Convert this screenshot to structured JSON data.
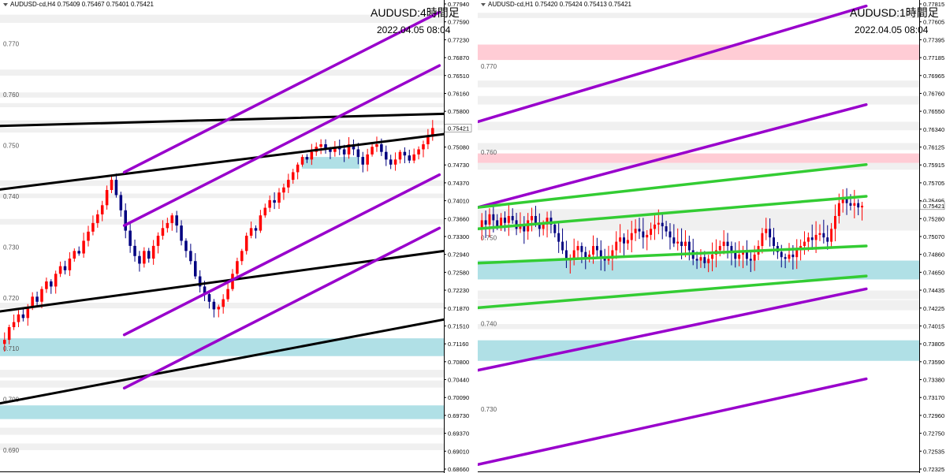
{
  "colors": {
    "purple": "#9900cc",
    "black": "#000000",
    "green": "#33cc33",
    "pink": "#ffccd5",
    "cyan": "#b0e0e6",
    "band": "#f0f0f0",
    "bull": "#ff0000",
    "bear": "#000080",
    "axis": "#000000",
    "price_label_bg": "#f0f0f0"
  },
  "chart_data": [
    {
      "type": "candlestick",
      "header": "AUDUSD-cd,H4  0.75409 0.75467 0.75401 0.75421",
      "title": "AUDUSD:4時間足",
      "timestamp": "2022.04.05 08:04",
      "ylim": [
        0.6866,
        0.7794
      ],
      "grid_labels": [
        "0.770",
        "0.760",
        "0.750",
        "0.740",
        "0.730",
        "0.720",
        "0.710",
        "0.700",
        "0.690"
      ],
      "grid_values": [
        0.77,
        0.76,
        0.75,
        0.74,
        0.73,
        0.72,
        0.71,
        0.7,
        0.69
      ],
      "axis_ticks": [
        "0.77940",
        "0.77590",
        "0.77230",
        "0.76870",
        "0.76510",
        "0.76160",
        "0.75800",
        "0.75421",
        "0.75080",
        "0.74730",
        "0.74370",
        "0.74010",
        "0.73660",
        "0.73300",
        "0.72940",
        "0.72580",
        "0.72230",
        "0.71870",
        "0.71510",
        "0.71160",
        "0.70800",
        "0.70440",
        "0.70090",
        "0.69730",
        "0.69370",
        "0.69010",
        "0.68660"
      ],
      "current_price": "0.75421",
      "zones": [
        {
          "kind": "band",
          "y1": 0.7765,
          "y2": 0.7749
        },
        {
          "kind": "band",
          "y1": 0.7657,
          "y2": 0.7645
        },
        {
          "kind": "band",
          "y1": 0.7612,
          "y2": 0.7602
        },
        {
          "kind": "band",
          "y1": 0.7591,
          "y2": 0.7583
        },
        {
          "kind": "band",
          "y1": 0.7557,
          "y2": 0.7548
        },
        {
          "kind": "band",
          "y1": 0.7542,
          "y2": 0.7533
        },
        {
          "kind": "cyan",
          "y1": 0.7485,
          "y2": 0.7462
        },
        {
          "kind": "band",
          "y1": 0.7439,
          "y2": 0.7428
        },
        {
          "kind": "band",
          "y1": 0.7413,
          "y2": 0.7404
        },
        {
          "kind": "band",
          "y1": 0.7363,
          "y2": 0.7352
        },
        {
          "kind": "band",
          "y1": 0.7198,
          "y2": 0.7187
        },
        {
          "kind": "cyan",
          "y1": 0.7128,
          "y2": 0.7093
        },
        {
          "kind": "band",
          "y1": 0.7066,
          "y2": 0.7051
        },
        {
          "kind": "band",
          "y1": 0.7045,
          "y2": 0.7031
        },
        {
          "kind": "cyan",
          "y1": 0.6996,
          "y2": 0.6969
        },
        {
          "kind": "band",
          "y1": 0.6952,
          "y2": 0.6938
        },
        {
          "kind": "band",
          "y1": 0.6921,
          "y2": 0.6908
        }
      ],
      "lines": [
        {
          "color": "black",
          "t1": 0,
          "p1": 0.7546,
          "t2": 1,
          "p2": 0.757
        },
        {
          "color": "black",
          "t1": 0,
          "p1": 0.7421,
          "t2": 1,
          "p2": 0.753
        },
        {
          "color": "black",
          "t1": 0,
          "p1": 0.7,
          "t2": 1,
          "p2": 0.7165
        },
        {
          "color": "black",
          "t1": 0,
          "p1": 0.7181,
          "t2": 1,
          "p2": 0.73
        },
        {
          "color": "purple",
          "t1": 0.28,
          "p1": 0.7455,
          "t2": 0.99,
          "p2": 0.777
        },
        {
          "color": "purple",
          "t1": 0.28,
          "p1": 0.735,
          "t2": 0.99,
          "p2": 0.7665
        },
        {
          "color": "purple",
          "t1": 0.28,
          "p1": 0.7135,
          "t2": 0.99,
          "p2": 0.745
        },
        {
          "color": "purple",
          "t1": 0.28,
          "p1": 0.703,
          "t2": 0.99,
          "p2": 0.7345
        }
      ],
      "candles": {
        "t_start": 0.005,
        "t_end": 0.98,
        "close": [
          0.7125,
          0.715,
          0.716,
          0.7175,
          0.7168,
          0.719,
          0.721,
          0.72,
          0.7225,
          0.724,
          0.723,
          0.7255,
          0.727,
          0.7262,
          0.7285,
          0.73,
          0.7295,
          0.732,
          0.7338,
          0.7355,
          0.7372,
          0.739,
          0.742,
          0.744,
          0.741,
          0.738,
          0.734,
          0.731,
          0.729,
          0.7275,
          0.73,
          0.7285,
          0.731,
          0.733,
          0.7345,
          0.7355,
          0.737,
          0.735,
          0.732,
          0.73,
          0.728,
          0.725,
          0.723,
          0.7215,
          0.72,
          0.7185,
          0.719,
          0.7205,
          0.7225,
          0.7255,
          0.728,
          0.73,
          0.733,
          0.7345,
          0.734,
          0.737,
          0.7385,
          0.74,
          0.7395,
          0.7415,
          0.7425,
          0.744,
          0.7455,
          0.747,
          0.7485,
          0.748,
          0.7495,
          0.7505,
          0.751,
          0.75,
          0.7495,
          0.7505,
          0.75,
          0.749,
          0.751,
          0.75,
          0.7485,
          0.747,
          0.749,
          0.7505,
          0.751,
          0.7495,
          0.748,
          0.747,
          0.748,
          0.7495,
          0.7488,
          0.7478,
          0.749,
          0.75,
          0.751,
          0.7525,
          0.7542
        ]
      }
    },
    {
      "type": "candlestick",
      "header": "AUDUSD-cd,H1  0.75420 0.75424 0.75413 0.75421",
      "title": "AUDUSD:1時間足",
      "timestamp": "2022.04.05 08:04",
      "ylim": [
        0.7232,
        0.7782
      ],
      "grid_labels": [
        "0.770",
        "0.760",
        "0.750",
        "0.740",
        "0.730"
      ],
      "grid_values": [
        0.77,
        0.76,
        0.75,
        0.74,
        0.73
      ],
      "axis_ticks": [
        "0.77815",
        "0.77605",
        "0.77395",
        "0.77185",
        "0.76965",
        "0.76760",
        "0.76550",
        "0.76340",
        "0.76125",
        "0.75915",
        "0.75705",
        "0.75495",
        "0.75280",
        "0.75070",
        "0.74860",
        "0.74650",
        "0.74435",
        "0.74225",
        "0.74015",
        "0.73805",
        "0.73590",
        "0.73380",
        "0.73170",
        "0.72960",
        "0.72750",
        "0.72535",
        "0.72325"
      ],
      "current_price": "0.75421",
      "zones": [
        {
          "kind": "band",
          "y1": 0.7767,
          "y2": 0.7761
        },
        {
          "kind": "pink",
          "y1": 0.773,
          "y2": 0.7712
        },
        {
          "kind": "band",
          "y1": 0.7688,
          "y2": 0.768
        },
        {
          "kind": "band",
          "y1": 0.767,
          "y2": 0.766
        },
        {
          "kind": "band",
          "y1": 0.764,
          "y2": 0.763
        },
        {
          "kind": "band",
          "y1": 0.7615,
          "y2": 0.7607
        },
        {
          "kind": "band",
          "y1": 0.7592,
          "y2": 0.7584
        },
        {
          "kind": "pink",
          "y1": 0.7603,
          "y2": 0.7592
        },
        {
          "kind": "band",
          "y1": 0.7538,
          "y2": 0.7513
        },
        {
          "kind": "cyan",
          "y1": 0.7478,
          "y2": 0.7456
        },
        {
          "kind": "band",
          "y1": 0.7443,
          "y2": 0.7433
        },
        {
          "kind": "band",
          "y1": 0.7432,
          "y2": 0.742
        },
        {
          "kind": "band",
          "y1": 0.7404,
          "y2": 0.7398
        },
        {
          "kind": "cyan",
          "y1": 0.7385,
          "y2": 0.7361
        }
      ],
      "lines": [
        {
          "color": "purple",
          "t1": 0,
          "p1": 0.764,
          "t2": 0.88,
          "p2": 0.7775
        },
        {
          "color": "purple",
          "t1": 0,
          "p1": 0.754,
          "t2": 0.88,
          "p2": 0.766
        },
        {
          "color": "purple",
          "t1": 0,
          "p1": 0.735,
          "t2": 0.88,
          "p2": 0.7445
        },
        {
          "color": "purple",
          "t1": 0,
          "p1": 0.724,
          "t2": 0.88,
          "p2": 0.734
        },
        {
          "color": "green",
          "t1": 0,
          "p1": 0.754,
          "t2": 0.88,
          "p2": 0.759
        },
        {
          "color": "green",
          "t1": 0,
          "p1": 0.7515,
          "t2": 0.88,
          "p2": 0.7553
        },
        {
          "color": "green",
          "t1": 0,
          "p1": 0.7475,
          "t2": 0.88,
          "p2": 0.7495
        },
        {
          "color": "green",
          "t1": 0,
          "p1": 0.7423,
          "t2": 0.88,
          "p2": 0.746
        }
      ],
      "candles": {
        "t_start": 0.005,
        "t_end": 0.875,
        "close": [
          0.7525,
          0.752,
          0.7532,
          0.7525,
          0.7518,
          0.7528,
          0.7522,
          0.753,
          0.7525,
          0.7515,
          0.752,
          0.7512,
          0.7525,
          0.753,
          0.7522,
          0.7515,
          0.752,
          0.7528,
          0.752,
          0.751,
          0.75,
          0.749,
          0.7478,
          0.748,
          0.749,
          0.7495,
          0.7488,
          0.748,
          0.7485,
          0.7495,
          0.749,
          0.7482,
          0.7478,
          0.748,
          0.749,
          0.75,
          0.7505,
          0.7498,
          0.7502,
          0.751,
          0.7515,
          0.7512,
          0.7505,
          0.7508,
          0.7515,
          0.752,
          0.7522,
          0.7518,
          0.7512,
          0.7505,
          0.7498,
          0.75,
          0.7495,
          0.75,
          0.749,
          0.748,
          0.7478,
          0.7482,
          0.7475,
          0.748,
          0.7485,
          0.749,
          0.7495,
          0.75,
          0.7495,
          0.7488,
          0.748,
          0.7485,
          0.749,
          0.748,
          0.7478,
          0.7485,
          0.7495,
          0.751,
          0.7515,
          0.7505,
          0.7495,
          0.7488,
          0.7482,
          0.748,
          0.7485,
          0.7482,
          0.749,
          0.7495,
          0.75,
          0.7505,
          0.7502,
          0.7508,
          0.751,
          0.7505,
          0.75,
          0.7515,
          0.753,
          0.7545,
          0.755,
          0.7545,
          0.7542,
          0.7545,
          0.754,
          0.7542
        ]
      }
    }
  ]
}
